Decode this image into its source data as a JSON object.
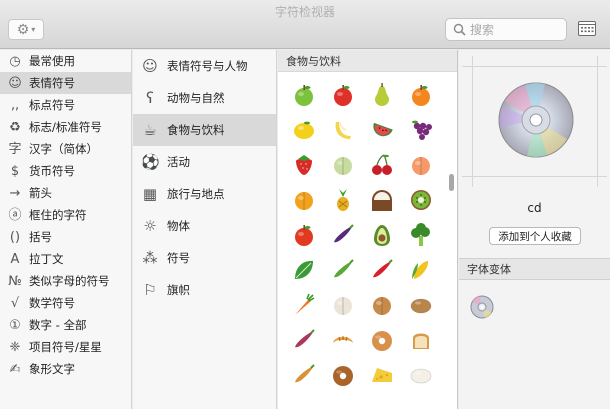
{
  "window": {
    "title": "字符检视器"
  },
  "toolbar": {
    "gear_icon": "gear-icon",
    "search_placeholder": "搜索",
    "search_value": "",
    "grid_icon": "keyboard-grid-icon"
  },
  "sidebar": {
    "items": [
      {
        "icon": "clock-icon",
        "glyph": "◷",
        "label": "最常使用",
        "selected": false
      },
      {
        "icon": "smiley-icon",
        "glyph": "☺",
        "label": "表情符号",
        "selected": true
      },
      {
        "icon": "punctuation-icon",
        "glyph": "‚,",
        "label": "标点符号",
        "selected": false
      },
      {
        "icon": "recycle-icon",
        "glyph": "♻",
        "label": "标志/标准符号",
        "selected": false
      },
      {
        "icon": "hanzi-icon",
        "glyph": "字",
        "label": "汉字（简体）",
        "selected": false
      },
      {
        "icon": "dollar-icon",
        "glyph": "$",
        "label": "货币符号",
        "selected": false
      },
      {
        "icon": "arrow-icon",
        "glyph": "→",
        "label": "箭头",
        "selected": false
      },
      {
        "icon": "circled-a-icon",
        "glyph": "ⓐ",
        "label": "框住的字符",
        "selected": false
      },
      {
        "icon": "parentheses-icon",
        "glyph": "()",
        "label": "括号",
        "selected": false
      },
      {
        "icon": "latin-a-icon",
        "glyph": "A",
        "label": "拉丁文",
        "selected": false
      },
      {
        "icon": "numero-icon",
        "glyph": "№",
        "label": "类似字母的符号",
        "selected": false
      },
      {
        "icon": "sqrt-icon",
        "glyph": "√",
        "label": "数学符号",
        "selected": false
      },
      {
        "icon": "circled-one-icon",
        "glyph": "①",
        "label": "数字 - 全部",
        "selected": false
      },
      {
        "icon": "asterisk-icon",
        "glyph": "❈",
        "label": "项目符号/星星",
        "selected": false
      },
      {
        "icon": "pictograph-icon",
        "glyph": "✍",
        "label": "象形文字",
        "selected": false
      }
    ]
  },
  "categories": {
    "items": [
      {
        "icon": "smiley-outline-icon",
        "glyph": "☺",
        "label": "表情符号与人物",
        "selected": false
      },
      {
        "icon": "bear-icon",
        "glyph": "ʕ",
        "label": "动物与自然",
        "selected": false
      },
      {
        "icon": "food-icon",
        "glyph": "☕",
        "label": "食物与饮料",
        "selected": true
      },
      {
        "icon": "soccer-ball-icon",
        "glyph": "⚽",
        "label": "活动",
        "selected": false
      },
      {
        "icon": "building-icon",
        "glyph": "▦",
        "label": "旅行与地点",
        "selected": false
      },
      {
        "icon": "lightbulb-icon",
        "glyph": "☼",
        "label": "物体",
        "selected": false
      },
      {
        "icon": "symbols-icon",
        "glyph": "⁂",
        "label": "符号",
        "selected": false
      },
      {
        "icon": "flag-icon",
        "glyph": "⚐",
        "label": "旗帜",
        "selected": false
      }
    ]
  },
  "emoji_panel": {
    "heading": "食物与饮料",
    "items": [
      {
        "name": "green-apple-icon",
        "shape": "apple",
        "color": "#7cc23a"
      },
      {
        "name": "red-apple-icon",
        "shape": "apple",
        "color": "#e0302a"
      },
      {
        "name": "pear-icon",
        "shape": "pear",
        "color": "#b8cc3a"
      },
      {
        "name": "tangerine-icon",
        "shape": "apple",
        "color": "#f5861f"
      },
      {
        "name": "lemon-icon",
        "shape": "lemon",
        "color": "#f3d019"
      },
      {
        "name": "banana-icon",
        "shape": "banana",
        "color": "#f3d54a"
      },
      {
        "name": "watermelon-icon",
        "shape": "melon-slice",
        "color": "#e84a4a"
      },
      {
        "name": "grapes-icon",
        "shape": "grapes",
        "color": "#7a2a7a"
      },
      {
        "name": "strawberry-icon",
        "shape": "berry",
        "color": "#d92a2a"
      },
      {
        "name": "melon-icon",
        "shape": "round",
        "color": "#c8dca0"
      },
      {
        "name": "cherries-icon",
        "shape": "cherries",
        "color": "#c81e2a"
      },
      {
        "name": "peach-icon",
        "shape": "round",
        "color": "#f79a6a"
      },
      {
        "name": "mango-icon",
        "shape": "round",
        "color": "#f2a21c"
      },
      {
        "name": "pineapple-icon",
        "shape": "pineapple",
        "color": "#e8b020"
      },
      {
        "name": "coconut-icon",
        "shape": "halfround",
        "color": "#7a4a26"
      },
      {
        "name": "kiwi-icon",
        "shape": "kiwi",
        "color": "#7ab83a"
      },
      {
        "name": "tomato-icon",
        "shape": "apple",
        "color": "#e23a22"
      },
      {
        "name": "eggplant-icon",
        "shape": "long",
        "color": "#5a2a7a"
      },
      {
        "name": "avocado-icon",
        "shape": "avocado",
        "color": "#5a8a2a"
      },
      {
        "name": "broccoli-icon",
        "shape": "broccoli",
        "color": "#3a8a2a"
      },
      {
        "name": "leafy-green-icon",
        "shape": "leaf",
        "color": "#3a9a3a"
      },
      {
        "name": "cucumber-icon",
        "shape": "long",
        "color": "#5aa83a"
      },
      {
        "name": "hot-pepper-icon",
        "shape": "long",
        "color": "#d8202a"
      },
      {
        "name": "corn-icon",
        "shape": "corn",
        "color": "#f2c41c"
      },
      {
        "name": "carrot-icon",
        "shape": "carrot",
        "color": "#f2761c"
      },
      {
        "name": "garlic-icon",
        "shape": "round",
        "color": "#ece4d8"
      },
      {
        "name": "onion-icon",
        "shape": "round",
        "color": "#c88a4a"
      },
      {
        "name": "potato-icon",
        "shape": "oval",
        "color": "#b8864a"
      },
      {
        "name": "sweet-potato-icon",
        "shape": "long",
        "color": "#a83a5a"
      },
      {
        "name": "croissant-icon",
        "shape": "croissant",
        "color": "#e8a03a"
      },
      {
        "name": "bagel-icon",
        "shape": "donut",
        "color": "#d8904a"
      },
      {
        "name": "bread-icon",
        "shape": "bread",
        "color": "#d89a4a"
      },
      {
        "name": "baguette-icon",
        "shape": "long",
        "color": "#d8923a"
      },
      {
        "name": "pretzel-icon",
        "shape": "donut",
        "color": "#a8642a"
      },
      {
        "name": "cheese-icon",
        "shape": "cheese",
        "color": "#f2cc3a"
      },
      {
        "name": "egg-icon",
        "shape": "oval",
        "color": "#f4f0e8"
      }
    ]
  },
  "detail": {
    "preview_icon": "optical-disc-icon",
    "name": "cd",
    "favorite_button": "添加到个人收藏",
    "variants_heading": "字体变体",
    "variant_icon": "optical-disc-small-icon"
  }
}
